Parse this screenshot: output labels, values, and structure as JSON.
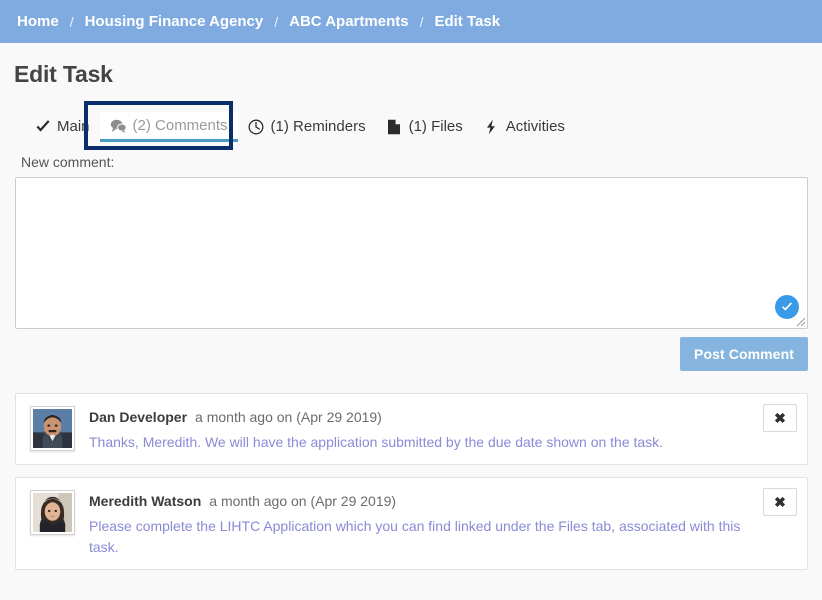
{
  "breadcrumb": {
    "separator": "/",
    "items": [
      {
        "label": "Home"
      },
      {
        "label": "Housing Finance Agency"
      },
      {
        "label": "ABC Apartments"
      },
      {
        "label": "Edit Task"
      }
    ]
  },
  "page": {
    "title": "Edit Task"
  },
  "tabs": {
    "items": [
      {
        "label": "Main",
        "icon": "check-icon",
        "active": false
      },
      {
        "label": "(2) Comments",
        "icon": "comments-icon",
        "active": true
      },
      {
        "label": "(1) Reminders",
        "icon": "clock-icon",
        "active": false
      },
      {
        "label": "(1) Files",
        "icon": "file-icon",
        "active": false
      },
      {
        "label": "Activities",
        "icon": "lightning-icon",
        "active": false
      }
    ],
    "highlighted": "(2) Comments"
  },
  "new_comment": {
    "label": "New comment:",
    "value": "",
    "placeholder": "",
    "validation_icon": "check-circle-icon",
    "post_button": "Post Comment"
  },
  "comments": [
    {
      "author": "Dan Developer",
      "timestamp": "a month ago on (Apr 29 2019)",
      "text": "Thanks, Meredith. We will have the application submitted by the due date shown on the task.",
      "avatar": "male-portrait",
      "delete_label": "✖"
    },
    {
      "author": "Meredith Watson",
      "timestamp": "a month ago on (Apr 29 2019)",
      "text": "Please complete the LIHTC Application which you can find linked under the Files tab, associated with this task.",
      "avatar": "female-portrait",
      "delete_label": "✖"
    }
  ],
  "colors": {
    "header_blue": "#7fabe0",
    "page_background": "#f9f9f9",
    "highlight_navy": "#0a2e6b",
    "tab_underline": "#4b9cc4",
    "button_blue": "#85b4de",
    "badge_blue": "#3b9ae8",
    "comment_text": "#8a8ad6"
  }
}
